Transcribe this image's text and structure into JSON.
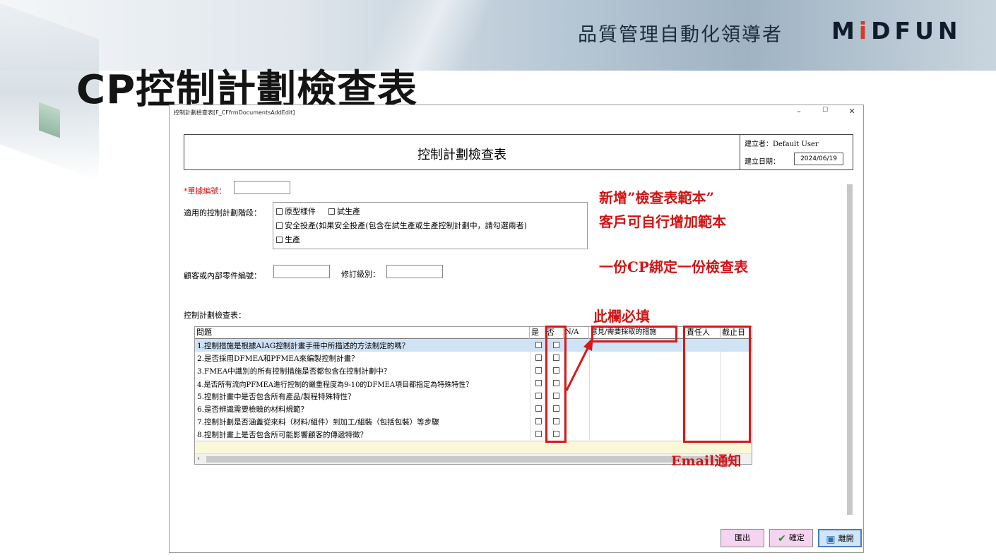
{
  "slide": {
    "tagline": "品質管理自動化領導者",
    "logo_pre": "M",
    "logo_i": "i",
    "logo_post": "DFUN",
    "title": "CP控制計劃檢查表"
  },
  "window": {
    "title": "控制計劃檢查表[F_CFfrmDocumentsAddEdit]",
    "minimize": "–",
    "maximize": "☐",
    "close": "✕"
  },
  "form": {
    "title": "控制計劃檢查表",
    "creator_label": "建立者：",
    "creator_value": "Default User",
    "date_label": "建立日期：",
    "date_value": "2024/06/19",
    "doc_no_label": "*單據編號：",
    "doc_no_value": "",
    "stage_label": "適用的控制計劃階段：",
    "stage_options": [
      "原型樣件",
      "試生產",
      "安全投產(如果安全投產(包含在試生產或生產控制計劃中，請勾選兩者)",
      "生產"
    ],
    "part_no_label": "顧客或內部零件編號：",
    "part_no_value": "",
    "revision_label": "修訂級別：",
    "revision_value": "",
    "checklist_label": "控制計劃檢查表："
  },
  "grid": {
    "columns": [
      "問題",
      "是",
      "否",
      "N/A",
      "意見/需要採取的措施",
      "責任人",
      "截止日"
    ],
    "rows": [
      "1.控制措施是根據AIAG控制計畫手冊中所描述的方法制定的嗎？",
      "2.是否採用DFMEA和PFMEA來編製控制計畫？",
      "3.FMEA中識別的所有控制措施是否都包含在控制計劃中？",
      "4.是否所有流向PFMEA進行控制的嚴重程度為9-10的DFMEA項目都指定為特殊特性？",
      "5.控制計畫中是否包含所有產品/製程特殊特性？",
      "6.是否辨識需要檢驗的材料規範？",
      "7.控制計劃是否涵蓋從來料（材料/組件）到加工/組裝（包括包裝）等步驟",
      "8.控制計畫上是否包含所可能影響顧客的傳遞特徵？"
    ],
    "scroll_left": "‹"
  },
  "annotations": {
    "line1": "新增”檢查表範本”",
    "line2": "客戶可自行增加範本",
    "line3": "一份CP綁定一份檢查表",
    "required": "此欄必填",
    "email": "Email通知"
  },
  "buttons": {
    "export": "匯出",
    "ok": "確定",
    "close": "離開"
  }
}
